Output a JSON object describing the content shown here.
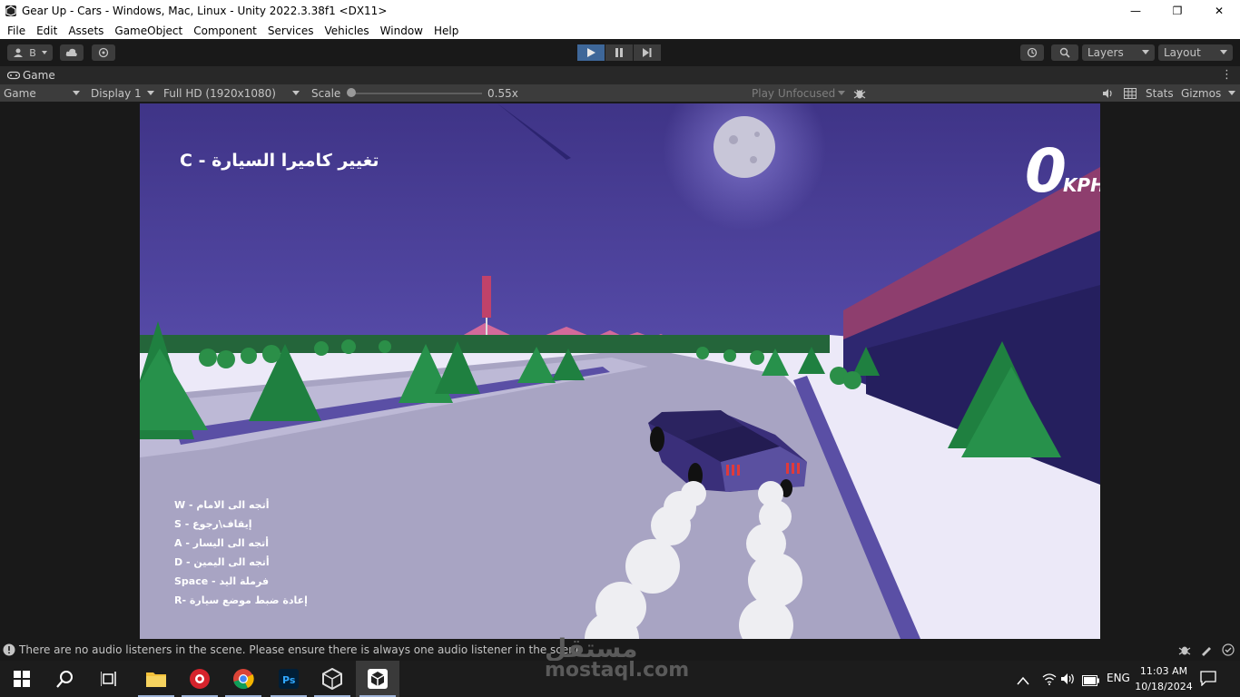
{
  "window": {
    "title": "Gear Up - Cars - Windows, Mac, Linux - Unity 2022.3.38f1 <DX11>",
    "minimize": "—",
    "maximize": "❐",
    "close": "✕"
  },
  "menu": [
    "File",
    "Edit",
    "Assets",
    "GameObject",
    "Component",
    "Services",
    "Vehicles",
    "Window",
    "Help"
  ],
  "toolbar": {
    "account_label": "B",
    "layers_label": "Layers",
    "layout_label": "Layout"
  },
  "tab": {
    "label": "Game"
  },
  "gamebar": {
    "mode": "Game",
    "display": "Display 1",
    "resolution": "Full HD (1920x1080)",
    "scale_label": "Scale",
    "scale_value": "0.55x",
    "play_focus": "Play Unfocused",
    "stats": "Stats",
    "gizmos": "Gizmos"
  },
  "scale_fraction": 0.0,
  "game": {
    "camera_hint": "تغيير كاميرا السيارة - C",
    "speed_value": "0",
    "speed_unit": "KPH",
    "controls": [
      "W - أتجه الى الامام",
      "S - إيقاف\\رجوع",
      "A - أتجه الى اليسار",
      "D - أتجه الى اليمين",
      "Space - فرملة اليد",
      "R- إعادة ضبط موضع سيارة"
    ]
  },
  "status": {
    "message": "There are no audio listeners in the scene. Please ensure there is always one audio listener in the scene"
  },
  "watermark": {
    "brand": "مستقل",
    "domain": "mostaql.com"
  },
  "taskbar": {
    "language": "ENG",
    "time": "11:03 AM",
    "date": "10/18/2024",
    "apps": [
      "windows-start",
      "search",
      "task-view",
      "file-explorer",
      "screen-recorder",
      "chrome",
      "photoshop",
      "unity-hub",
      "unity-editor"
    ]
  },
  "colors": {
    "sky_top": "#4a3e8f",
    "sky_horizon": "#6a5fb5",
    "road": "#a7a3c2",
    "snow": "#f0effb",
    "play_active": "#3e6799",
    "editor_bg": "#191919"
  }
}
